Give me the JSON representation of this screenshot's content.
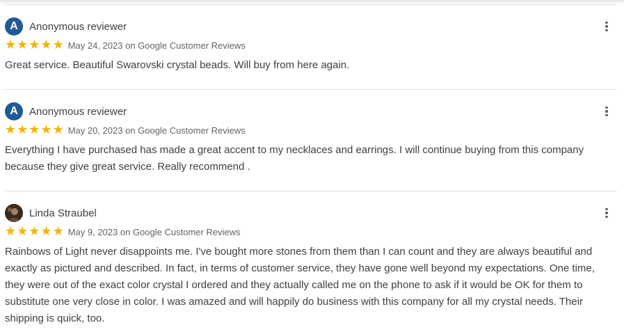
{
  "reviews": [
    {
      "avatar_letter": "A",
      "avatar_color": "#1f5a96",
      "name": "Anonymous reviewer",
      "rating": 5,
      "date_source": "May 24, 2023 on Google Customer Reviews",
      "text": "Great service. Beautiful Swarovski crystal beads. Will buy from here again."
    },
    {
      "avatar_letter": "A",
      "avatar_color": "#1f5a96",
      "name": "Anonymous reviewer",
      "rating": 5,
      "date_source": "May 20, 2023 on Google Customer Reviews",
      "text": "Everything I have purchased has made a great accent to my necklaces and earrings. I will continue buying from this company because they give great service. Really recommend ."
    },
    {
      "avatar_letter": "",
      "avatar_icon": "profile-photo",
      "name": "Linda Straubel",
      "rating": 5,
      "date_source": "May 9, 2023 on Google Customer Reviews",
      "text": "Rainbows of Light never disappoints me. I've bought more stones from them than I can count and they are always beautiful and exactly as pictured and described. In fact, in terms of customer service, they have gone well beyond my expectations. One time, they were out of the exact color crystal I ordered and they actually called me on the phone to ask if it would be OK for them to substitute one very close in color. I was amazed and will happily do business with this company for all my crystal needs. Their shipping is quick, too."
    }
  ],
  "star_color": "#f4b400",
  "more_icon": "more-vertical-icon"
}
